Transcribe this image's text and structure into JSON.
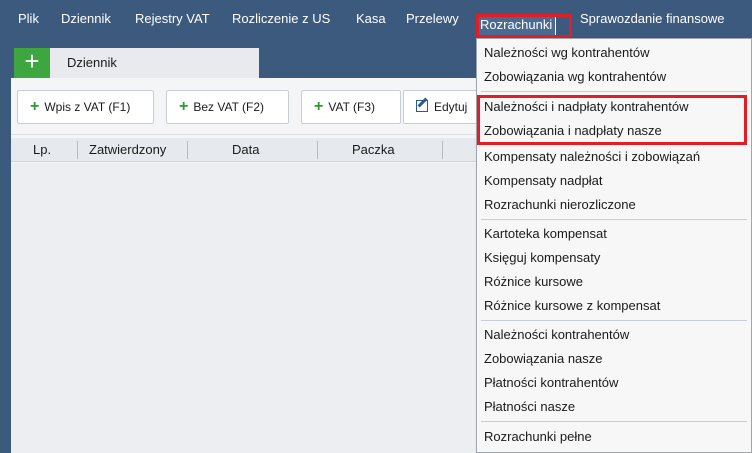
{
  "menubar": {
    "items": [
      {
        "label": "Plik"
      },
      {
        "label": "Dziennik"
      },
      {
        "label": "Rejestry VAT"
      },
      {
        "label": "Rozliczenie z US"
      },
      {
        "label": "Kasa"
      },
      {
        "label": "Przelewy"
      },
      {
        "label": "Rozrachunki",
        "active": true
      },
      {
        "label": "Sprawozdanie finansowe"
      }
    ]
  },
  "tabs": {
    "add_label": "+",
    "journal_label": "Dziennik"
  },
  "toolbar": {
    "buttons": [
      {
        "label": "Wpis z VAT (F1)"
      },
      {
        "label": "Bez VAT (F2)"
      },
      {
        "label": "VAT (F3)"
      },
      {
        "label": "Edytuj"
      }
    ]
  },
  "grid": {
    "columns": [
      "Lp.",
      "Zatwierdzony",
      "Data",
      "Paczka"
    ]
  },
  "dropdown": {
    "items": [
      "Należności wg kontrahentów",
      "Zobowiązania wg kontrahentów",
      "Należności i nadpłaty kontrahentów",
      "Zobowiązania i nadpłaty nasze",
      "Kompensaty należności i zobowiązań",
      "Kompensaty nadpłat",
      "Rozrachunki nierozliczone",
      "Kartoteka kompensat",
      "Księguj kompensaty",
      "Różnice kursowe",
      "Różnice kursowe z kompensat",
      "Należności kontrahentów",
      "Zobowiązania nasze",
      "Płatności kontrahentów",
      "Płatności nasze",
      "Rozrachunki pełne"
    ]
  },
  "colors": {
    "menubar_bg": "#3c5a7e",
    "add_tab_green": "#3ea63e",
    "highlight_red": "#e11d25"
  }
}
